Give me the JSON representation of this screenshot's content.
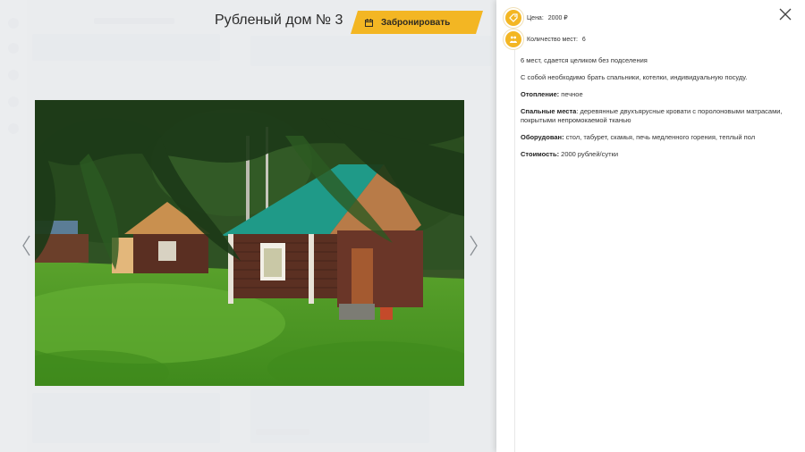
{
  "listing": {
    "title": "Рубленый дом № 3",
    "book_label": "Забронировать"
  },
  "details": {
    "price_label": "Цена:",
    "price_value": "2000 ₽",
    "capacity_label": "Количество мест:",
    "capacity_value": "6",
    "summary": "6 мест, сдается целиком без подселения",
    "bring": "С собой необходимо брать спальники, котелки, индивидуальную посуду.",
    "heating_label": "Отопление:",
    "heating_value": " печное",
    "beds_label": "Спальные места",
    "beds_value": ": деревянные двухъярусные кровати с поролоновыми матрасами, покрытыми непромокаемой тканью",
    "equipped_label": "Оборудован:",
    "equipped_value": " стол, табурет, скамья, печь медленного горения, теплый пол",
    "cost_label": "Стоимость:",
    "cost_value": " 2000 рублей/сутки"
  },
  "icons": {
    "book": "calendar-icon",
    "price": "price-tag-icon",
    "capacity": "people-icon",
    "close": "close-icon",
    "prev": "chevron-left-icon",
    "next": "chevron-right-icon"
  },
  "colors": {
    "accent": "#f3b623",
    "panel": "#ffffff",
    "overlay": "#eceef0"
  }
}
